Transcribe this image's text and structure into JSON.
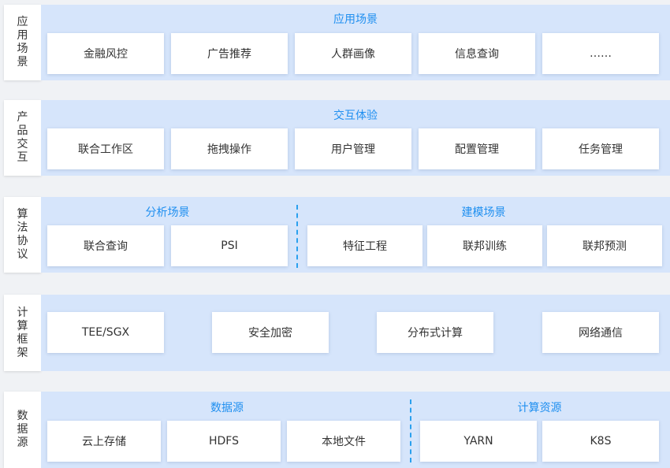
{
  "layers": [
    {
      "side": "应用场景",
      "groups": [
        {
          "title": "应用场景",
          "items": [
            "金融风控",
            "广告推荐",
            "人群画像",
            "信息查询",
            "……"
          ]
        }
      ]
    },
    {
      "side": "产品交互",
      "groups": [
        {
          "title": "交互体验",
          "items": [
            "联合工作区",
            "拖拽操作",
            "用户管理",
            "配置管理",
            "任务管理"
          ]
        }
      ]
    },
    {
      "side": "算法协议",
      "groups": [
        {
          "title": "分析场景",
          "items": [
            "联合查询",
            "PSI"
          ]
        },
        {
          "title": "建模场景",
          "items": [
            "特征工程",
            "联邦训练",
            "联邦预测"
          ]
        }
      ]
    },
    {
      "side": "计算框架",
      "groups": [
        {
          "title": "",
          "items": [
            "TEE/SGX",
            "安全加密",
            "分布式计算",
            "网络通信"
          ]
        }
      ]
    },
    {
      "side": "数据源",
      "groups": [
        {
          "title": "数据源",
          "items": [
            "云上存储",
            "HDFS",
            "本地文件"
          ]
        },
        {
          "title": "计算资源",
          "items": [
            "YARN",
            "K8S"
          ]
        }
      ]
    }
  ],
  "colors": {
    "panel": "#d6e5fb",
    "accent": "#1f8ff0",
    "card": "#ffffff",
    "page": "#f0f2f5"
  }
}
